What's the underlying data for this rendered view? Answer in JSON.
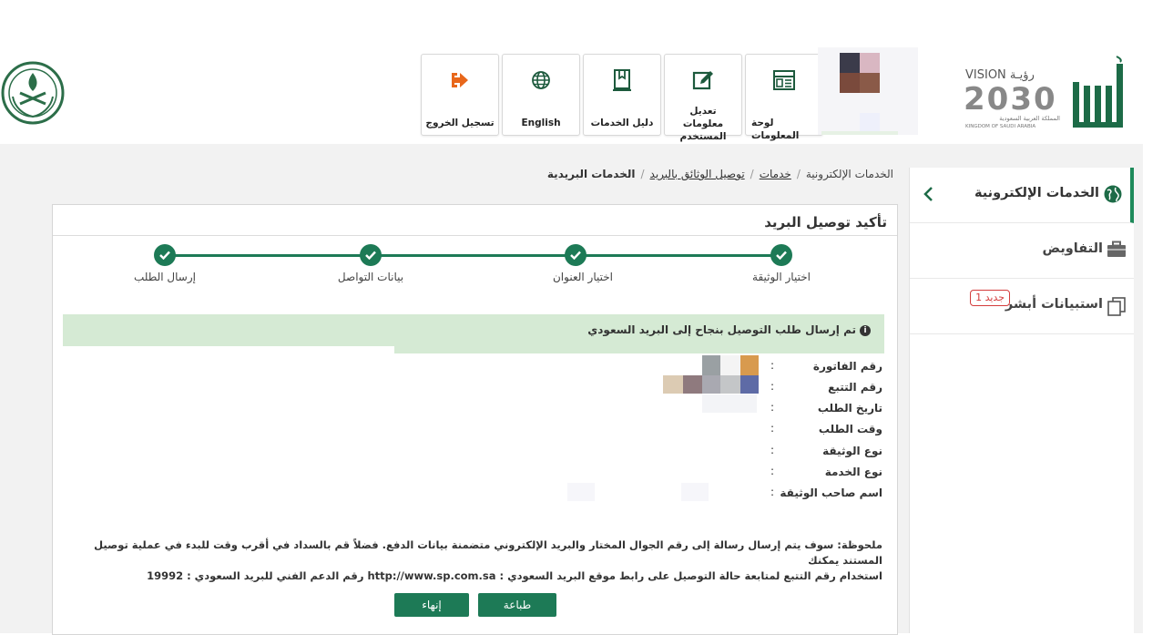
{
  "header": {
    "nav": [
      {
        "label": "تسجيل الخروج",
        "icon": "logout-icon"
      },
      {
        "label": "English",
        "icon": "globe-icon"
      },
      {
        "label": "دليل الخدمات",
        "icon": "book-icon"
      },
      {
        "label": "تعديل معلومات المستخدم",
        "icon": "edit-icon"
      },
      {
        "label": "لوحة المعلومات",
        "icon": "dashboard-icon"
      }
    ],
    "vision_title": "VISION رؤيـة",
    "vision_year": "2030",
    "vision_sub_ar": "المملكة العربية السعودية",
    "vision_sub_en": "KINGDOM OF SAUDI ARABIA",
    "absher_logo": "أبشر"
  },
  "sidebar": {
    "items": [
      {
        "label": "الخدمات الإلكترونية",
        "icon": "globe-map-icon",
        "active": true
      },
      {
        "label": "التفاويض",
        "icon": "briefcase-icon"
      },
      {
        "label": "استبيانات أبشر",
        "icon": "copy-icon",
        "badge": "جديد 1"
      }
    ]
  },
  "breadcrumb": {
    "items": [
      "الخدمات الإلكترونية",
      "خدمات",
      "توصيل الوثائق بالبريد",
      "الخدمات البريدية"
    ]
  },
  "panel": {
    "title": "تأكيد توصيل البريد",
    "steps": [
      "اختيار الوثيقة",
      "اختيار العنوان",
      "بيانات التواصل",
      "إرسال الطلب"
    ],
    "alert": "تم إرسال طلب التوصيل بنجاح إلى البريد السعودي",
    "details": [
      {
        "label": "رقم الفاتورة",
        "colon": ":"
      },
      {
        "label": "رقم التتبع",
        "colon": ":"
      },
      {
        "label": "تاريخ الطلب",
        "colon": ":"
      },
      {
        "label": "وقت الطلب",
        "colon": ":"
      },
      {
        "label": "نوع الوثيقة",
        "colon": ":"
      },
      {
        "label": "نوع الخدمة",
        "colon": ":"
      },
      {
        "label": "اسم صاحب الوثيقة",
        "colon": ":"
      }
    ],
    "note_line1": "ملحوظة: سوف يتم إرسال رسالة إلى رقم الجوال المختار والبريد الإلكتروني متضمنة بيانات الدفع. فضلاً قم بالسداد في أقرب وقت للبدء في عملية توصيل المستند يمكنك",
    "note_line2_a": "استخدام رقم التتبع لمتابعة حالة التوصيل على رابط موقع البريد السعودي :",
    "note_link": "http://www.sp.com.sa",
    "note_line2_b": "رقم الدعم الفني للبريد السعودي : 19992",
    "buttons": {
      "print": "طباعة",
      "finish": "إنهاء"
    }
  },
  "colors": {
    "primary": "#1d7a56",
    "alert_bg": "#d5ead4",
    "badge": "#d43c3c"
  }
}
